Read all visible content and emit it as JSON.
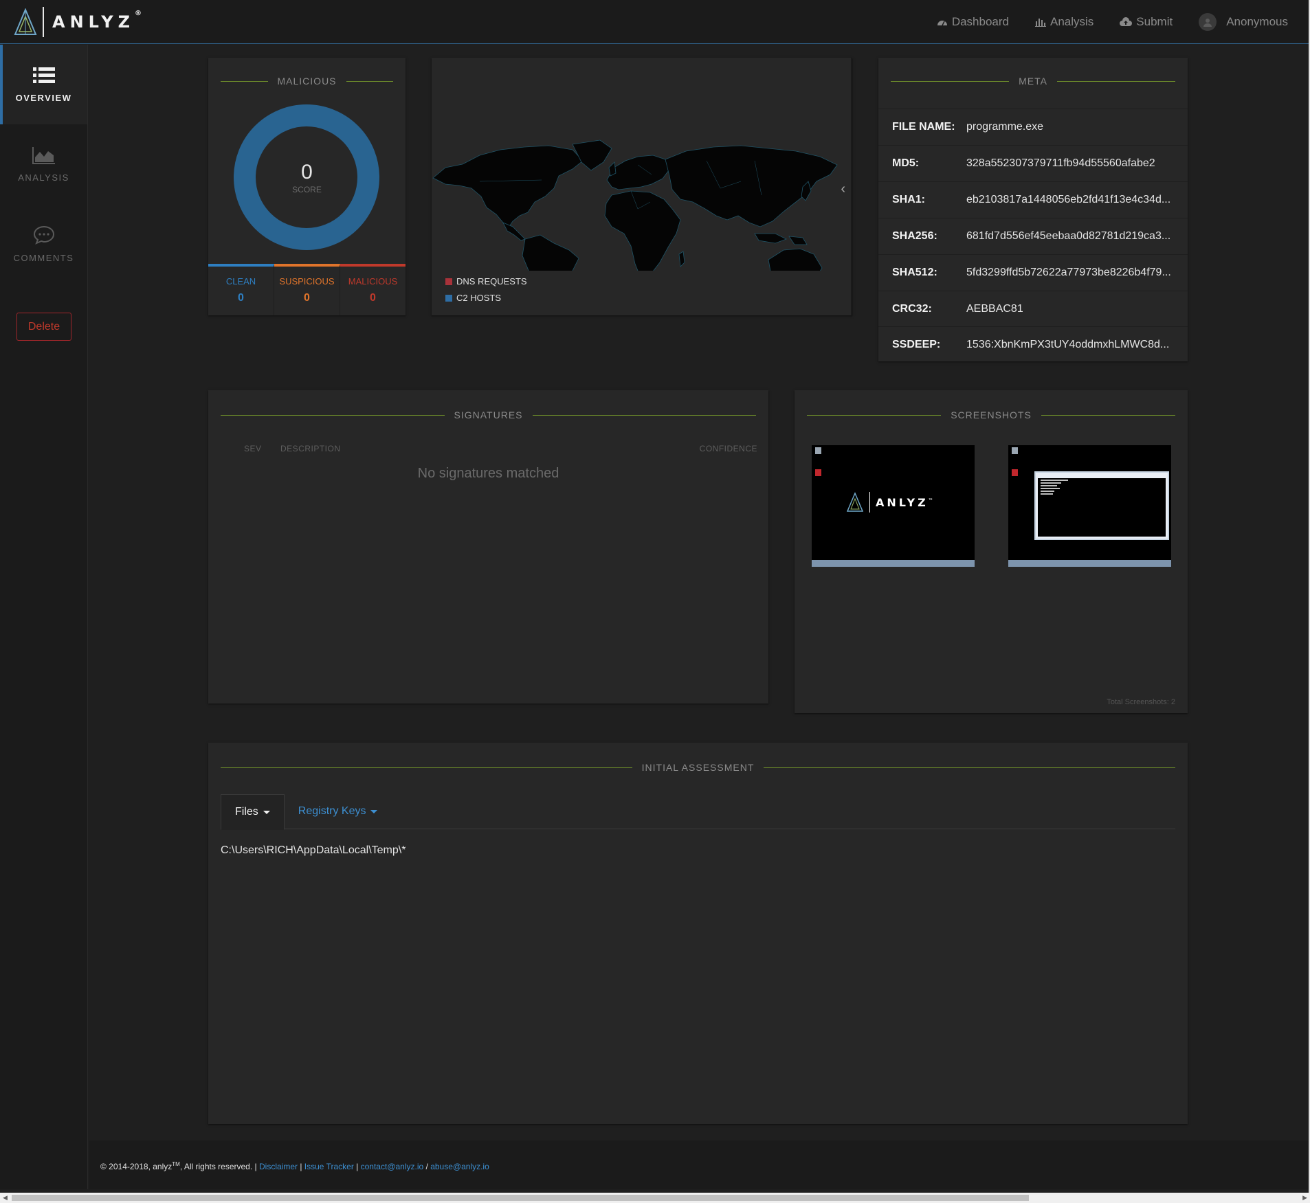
{
  "brand": {
    "name": "ANLYZ",
    "mark": "®"
  },
  "nav": {
    "dashboard": "Dashboard",
    "analysis": "Analysis",
    "submit": "Submit",
    "user": "Anonymous"
  },
  "sidebar": {
    "items": [
      {
        "label": "OVERVIEW",
        "icon": "list-icon"
      },
      {
        "label": "ANALYSIS",
        "icon": "area-chart-icon"
      },
      {
        "label": "COMMENTS",
        "icon": "comment-icon"
      }
    ],
    "delete": "Delete"
  },
  "malicious": {
    "title": "MALICIOUS",
    "score": "0",
    "score_label": "SCORE",
    "stats": [
      {
        "label": "CLEAN",
        "value": "0",
        "color": "#2e7fc2"
      },
      {
        "label": "SUSPICIOUS",
        "value": "0",
        "color": "#e0742b"
      },
      {
        "label": "MALICIOUS",
        "value": "0",
        "color": "#c0392b"
      }
    ]
  },
  "map": {
    "legend": [
      {
        "label": "DNS REQUESTS",
        "color": "#a8323a"
      },
      {
        "label": "C2 HOSTS",
        "color": "#2e6da4"
      }
    ]
  },
  "meta": {
    "title": "META",
    "rows": [
      {
        "key": "FILE NAME:",
        "value": "programme.exe"
      },
      {
        "key": "MD5:",
        "value": "328a552307379711fb94d55560afabe2"
      },
      {
        "key": "SHA1:",
        "value": "eb2103817a1448056eb2fd41f13e4c34d..."
      },
      {
        "key": "SHA256:",
        "value": "681fd7d556ef45eebaa0d82781d219ca3..."
      },
      {
        "key": "SHA512:",
        "value": "5fd3299ffd5b72622a77973be8226b4f79..."
      },
      {
        "key": "CRC32:",
        "value": "AEBBAC81"
      },
      {
        "key": "SSDEEP:",
        "value": "1536:XbnKmPX3tUY4oddmxhLMWC8d..."
      }
    ]
  },
  "signatures": {
    "title": "SIGNATURES",
    "col_sev": "SEV",
    "col_desc": "DESCRIPTION",
    "col_conf": "CONFIDENCE",
    "empty": "No signatures matched"
  },
  "screenshots": {
    "title": "SCREENSHOTS",
    "logo_text": "ANLYZ",
    "logo_mark": "™",
    "total": "Total Screenshots: 2"
  },
  "assessment": {
    "title": "INITIAL ASSESSMENT",
    "tabs": [
      "Files",
      "Registry Keys"
    ],
    "path": "C:\\Users\\RICH\\AppData\\Local\\Temp\\*"
  },
  "footer": {
    "copyright": "© 2014-2018, anlyz",
    "tm": "TM",
    "rights": ", All rights reserved. |",
    "disclaimer": "Disclaimer",
    "issue_tracker": "Issue Tracker",
    "contact": "contact@anlyz.io",
    "abuse": "abuse@anlyz.io"
  }
}
